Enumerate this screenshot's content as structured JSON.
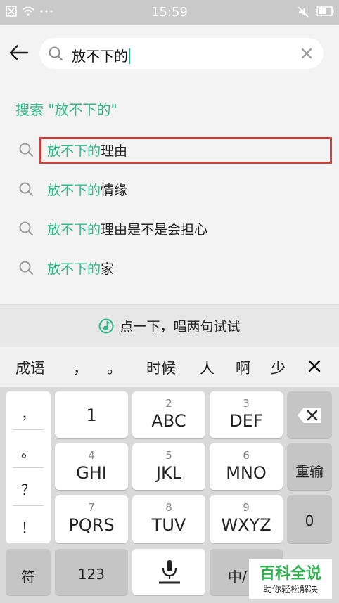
{
  "status_bar": {
    "time": "15:59"
  },
  "search": {
    "query": "放不下的"
  },
  "search_suggestion": "搜索 \"放不下的\"",
  "suggestions": [
    {
      "highlight": "放不下的",
      "rest": "理由",
      "selected": true
    },
    {
      "highlight": "放不下的",
      "rest": "情缘"
    },
    {
      "highlight": "放不下的",
      "rest": "理由是不是会担心"
    },
    {
      "highlight": "放不下的",
      "rest": "家"
    }
  ],
  "voice_prompt": "点一下，唱两句试试",
  "candidates": [
    "成语",
    "，",
    "。",
    "时候",
    "人",
    "啊",
    "少"
  ],
  "keyboard": {
    "punctuation": [
      "，",
      "。",
      "？",
      "！"
    ],
    "keys": [
      {
        "num": "",
        "label": "1"
      },
      {
        "num": "2",
        "label": "ABC"
      },
      {
        "num": "3",
        "label": "DEF"
      },
      {
        "num": "4",
        "label": "GHI"
      },
      {
        "num": "5",
        "label": "JKL"
      },
      {
        "num": "6",
        "label": "MNO"
      },
      {
        "num": "7",
        "label": "PQRS"
      },
      {
        "num": "8",
        "label": "TUV"
      },
      {
        "num": "9",
        "label": "WXYZ"
      }
    ],
    "reinput": "重输",
    "zero": "0",
    "symbol": "符",
    "numbers": "123",
    "lang_switch": "中/"
  },
  "watermark": {
    "main": "百科全说",
    "sub": "助你轻松解决"
  },
  "colors": {
    "accent": "#2fb98c",
    "selection_border": "#c9413b",
    "statusbar_bg": "#c9c9c9"
  }
}
